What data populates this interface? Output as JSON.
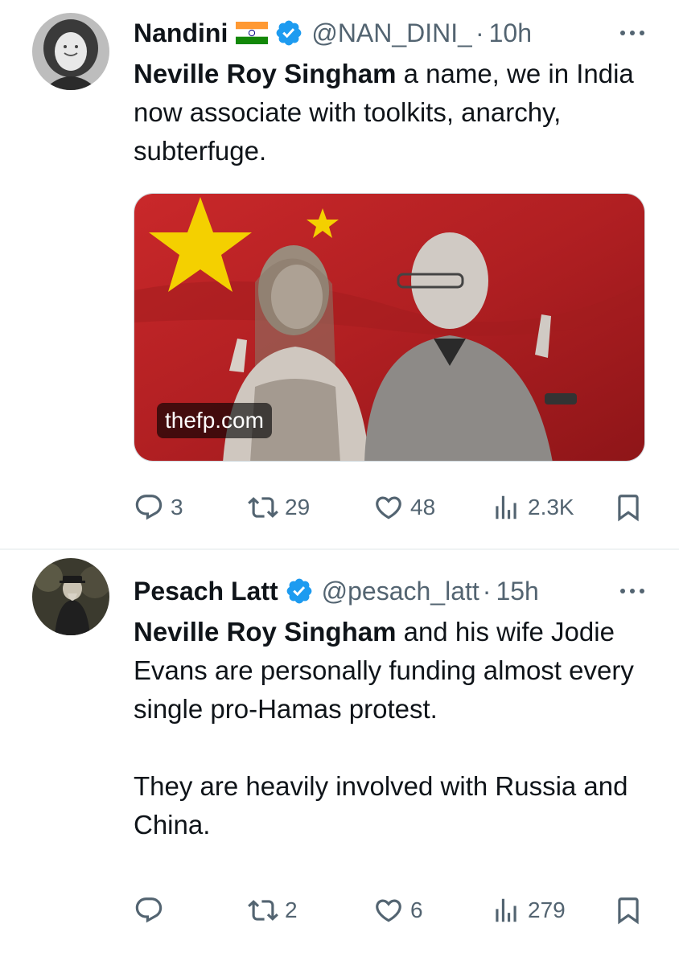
{
  "tweets": [
    {
      "author": "Nandini",
      "handle": "@NAN_DINI_",
      "separator": "·",
      "time": "10h",
      "text_bold": "Neville Roy Singham",
      "text_rest": " a name, we in India now associate with toolkits, anarchy, subterfuge.",
      "media_domain": "thefp.com",
      "stats": {
        "replies": "3",
        "reposts": "29",
        "likes": "48",
        "views": "2.3K"
      }
    },
    {
      "author": "Pesach Latt",
      "handle": "@pesach_latt",
      "separator": "·",
      "time": "15h",
      "text_bold": "Neville Roy Singham",
      "text_rest": " and his wife Jodie Evans are personally funding almost every single pro-Hamas protest.\n\nThey are heavily involved with Russia and China.",
      "stats": {
        "replies": "",
        "reposts": "2",
        "likes": "6",
        "views": "279"
      }
    }
  ],
  "colors": {
    "text": "#0f1419",
    "secondary": "#536471",
    "verified": "#1d9bf0",
    "divider": "#eff3f4"
  },
  "icons": [
    "flag-india-icon",
    "verified-badge-icon",
    "more-icon",
    "reply-icon",
    "repost-icon",
    "like-icon",
    "views-icon",
    "bookmark-icon"
  ]
}
